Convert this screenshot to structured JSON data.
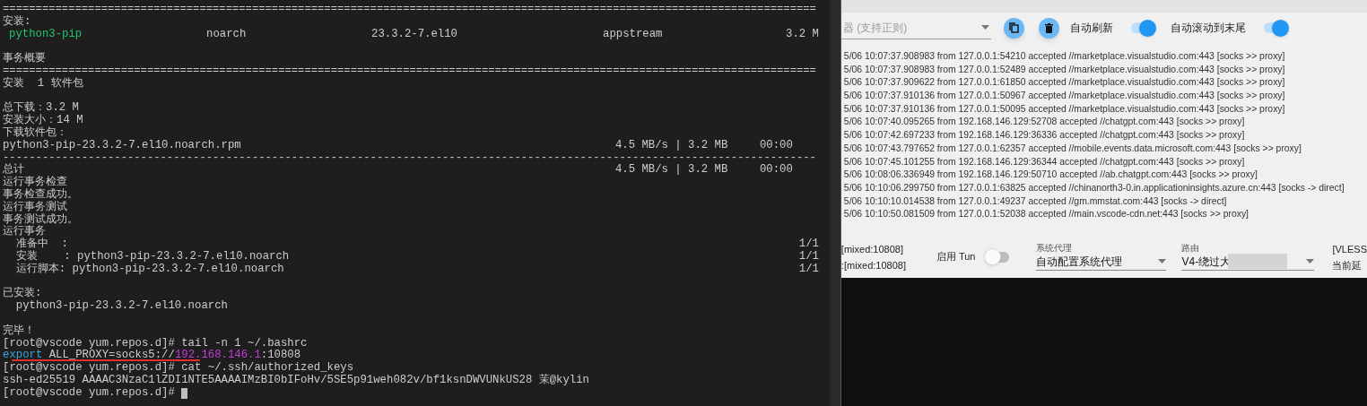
{
  "terminal": {
    "lines": [
      {
        "kind": "rule",
        "text": "============================================================================================================================"
      },
      {
        "kind": "plain",
        "text": "安装:"
      },
      {
        "kind": "row",
        "cells": [
          {
            "text": "python3-pip",
            "color": "#23c26b"
          },
          {
            "text": "noarch",
            "color": "#cccccc"
          },
          {
            "text": "23.3.2-7.el10",
            "color": "#cccccc"
          },
          {
            "text": "appstream",
            "color": "#cccccc"
          },
          {
            "text": "3.2 M",
            "color": "#cccccc"
          }
        ]
      },
      {
        "kind": "blank"
      },
      {
        "kind": "plain",
        "text": "事务概要"
      },
      {
        "kind": "rule",
        "text": "============================================================================================================================"
      },
      {
        "kind": "plain",
        "text": "安装  1 软件包"
      },
      {
        "kind": "blank"
      },
      {
        "kind": "plain",
        "text": "总下载：3.2 M"
      },
      {
        "kind": "plain",
        "text": "安装大小：14 M"
      },
      {
        "kind": "plain",
        "text": "下载软件包："
      },
      {
        "kind": "progress",
        "text": "python3-pip-23.3.2-7.el10.noarch.rpm",
        "stat": "4.5 MB/s | 3.2 MB",
        "time": "00:00"
      },
      {
        "kind": "rule",
        "text": "----------------------------------------------------------------------------------------------------------------------------"
      },
      {
        "kind": "progress",
        "text": "总计",
        "stat": "4.5 MB/s | 3.2 MB",
        "time": "00:00"
      },
      {
        "kind": "plain",
        "text": "运行事务检查"
      },
      {
        "kind": "plain",
        "text": "事务检查成功。"
      },
      {
        "kind": "plain",
        "text": "运行事务测试"
      },
      {
        "kind": "plain",
        "text": "事务测试成功。"
      },
      {
        "kind": "plain",
        "text": "运行事务"
      },
      {
        "kind": "count",
        "text": "  准备中  :",
        "count": "1/1"
      },
      {
        "kind": "count",
        "text": "  安装    : python3-pip-23.3.2-7.el10.noarch",
        "count": "1/1"
      },
      {
        "kind": "count",
        "text": "  运行脚本: python3-pip-23.3.2-7.el10.noarch",
        "count": "1/1"
      },
      {
        "kind": "blank"
      },
      {
        "kind": "plain",
        "text": "已安装:"
      },
      {
        "kind": "plain",
        "text": "  python3-pip-23.3.2-7.el10.noarch"
      },
      {
        "kind": "blank"
      },
      {
        "kind": "plain",
        "text": "完毕！"
      },
      {
        "kind": "plain",
        "text": "[root@vscode yum.repos.d]# tail -n 1 ~/.bashrc"
      },
      {
        "kind": "colored",
        "underlined": true,
        "segments": [
          {
            "text": "export",
            "color": "#3aa6dd"
          },
          {
            "text": " ALL_PROXY=socks5://",
            "color": "#cccccc"
          },
          {
            "text": "192.168.146.1",
            "color": "#c43bd8"
          },
          {
            "text": ":10808",
            "color": "#cccccc"
          }
        ]
      },
      {
        "kind": "plain",
        "text": "[root@vscode yum.repos.d]# cat ~/.ssh/authorized_keys"
      },
      {
        "kind": "plain",
        "text": "ssh-ed25519 AAAAC3NzaC1lZDI1NTE5AAAAIMzBI0bIFoHv/5SE5p91weh082v/bf1ksnDWVUNkUS28 茉@kylin"
      },
      {
        "kind": "prompt",
        "text": "[root@vscode yum.repos.d]#"
      }
    ]
  },
  "proxy": {
    "filter": {
      "placeholder": "器 (支持正则)"
    },
    "toggles": [
      {
        "label": "自动刷新",
        "on": true
      },
      {
        "label": "自动滚动到末尾",
        "on": true
      }
    ],
    "log": [
      "5/06 10:07:37.908983 from 127.0.0.1:54210 accepted //marketplace.visualstudio.com:443 [socks >> proxy]",
      "5/06 10:07:37.908983 from 127.0.0.1:52489 accepted //marketplace.visualstudio.com:443 [socks >> proxy]",
      "5/06 10:07:37.909622 from 127.0.0.1:61850 accepted //marketplace.visualstudio.com:443 [socks >> proxy]",
      "5/06 10:07:37.910136 from 127.0.0.1:50967 accepted //marketplace.visualstudio.com:443 [socks >> proxy]",
      "5/06 10:07:37.910136 from 127.0.0.1:50095 accepted //marketplace.visualstudio.com:443 [socks >> proxy]",
      "5/06 10:07:40.095265 from 192.168.146.129:52708 accepted //chatgpt.com:443 [socks >> proxy]",
      "5/06 10:07:42.697233 from 192.168.146.129:36336 accepted //chatgpt.com:443 [socks >> proxy]",
      "5/06 10:07:43.797652 from 127.0.0.1:62357 accepted //mobile.events.data.microsoft.com:443 [socks >> proxy]",
      "5/06 10:07:45.101255 from 192.168.146.129:36344 accepted //chatgpt.com:443 [socks >> proxy]",
      "5/06 10:08:06.336949 from 192.168.146.129:50710 accepted //ab.chatgpt.com:443 [socks >> proxy]",
      "5/06 10:10:06.299750 from 127.0.0.1:63825 accepted //chinanorth3-0.in.applicationinsights.azure.cn:443 [socks -> direct]",
      "5/06 10:10:10.014538 from 127.0.0.1:49237 accepted //gm.mmstat.com:443 [socks -> direct]",
      "5/06 10:10:50.081509 from 127.0.0.1:52038 accepted //main.vscode-cdn.net:443 [socks >> proxy]"
    ],
    "ports": [
      "[mixed:10808]",
      ":[mixed:10808]"
    ],
    "tun": {
      "label": "启用 Tun",
      "on": false
    },
    "selects": [
      {
        "label": "系统代理",
        "value": "自动配置系统代理",
        "redacted": false
      },
      {
        "label": "路由",
        "value": "V4-绕过大",
        "redacted": true
      }
    ],
    "status": [
      "[VLESS",
      "当前延"
    ]
  }
}
